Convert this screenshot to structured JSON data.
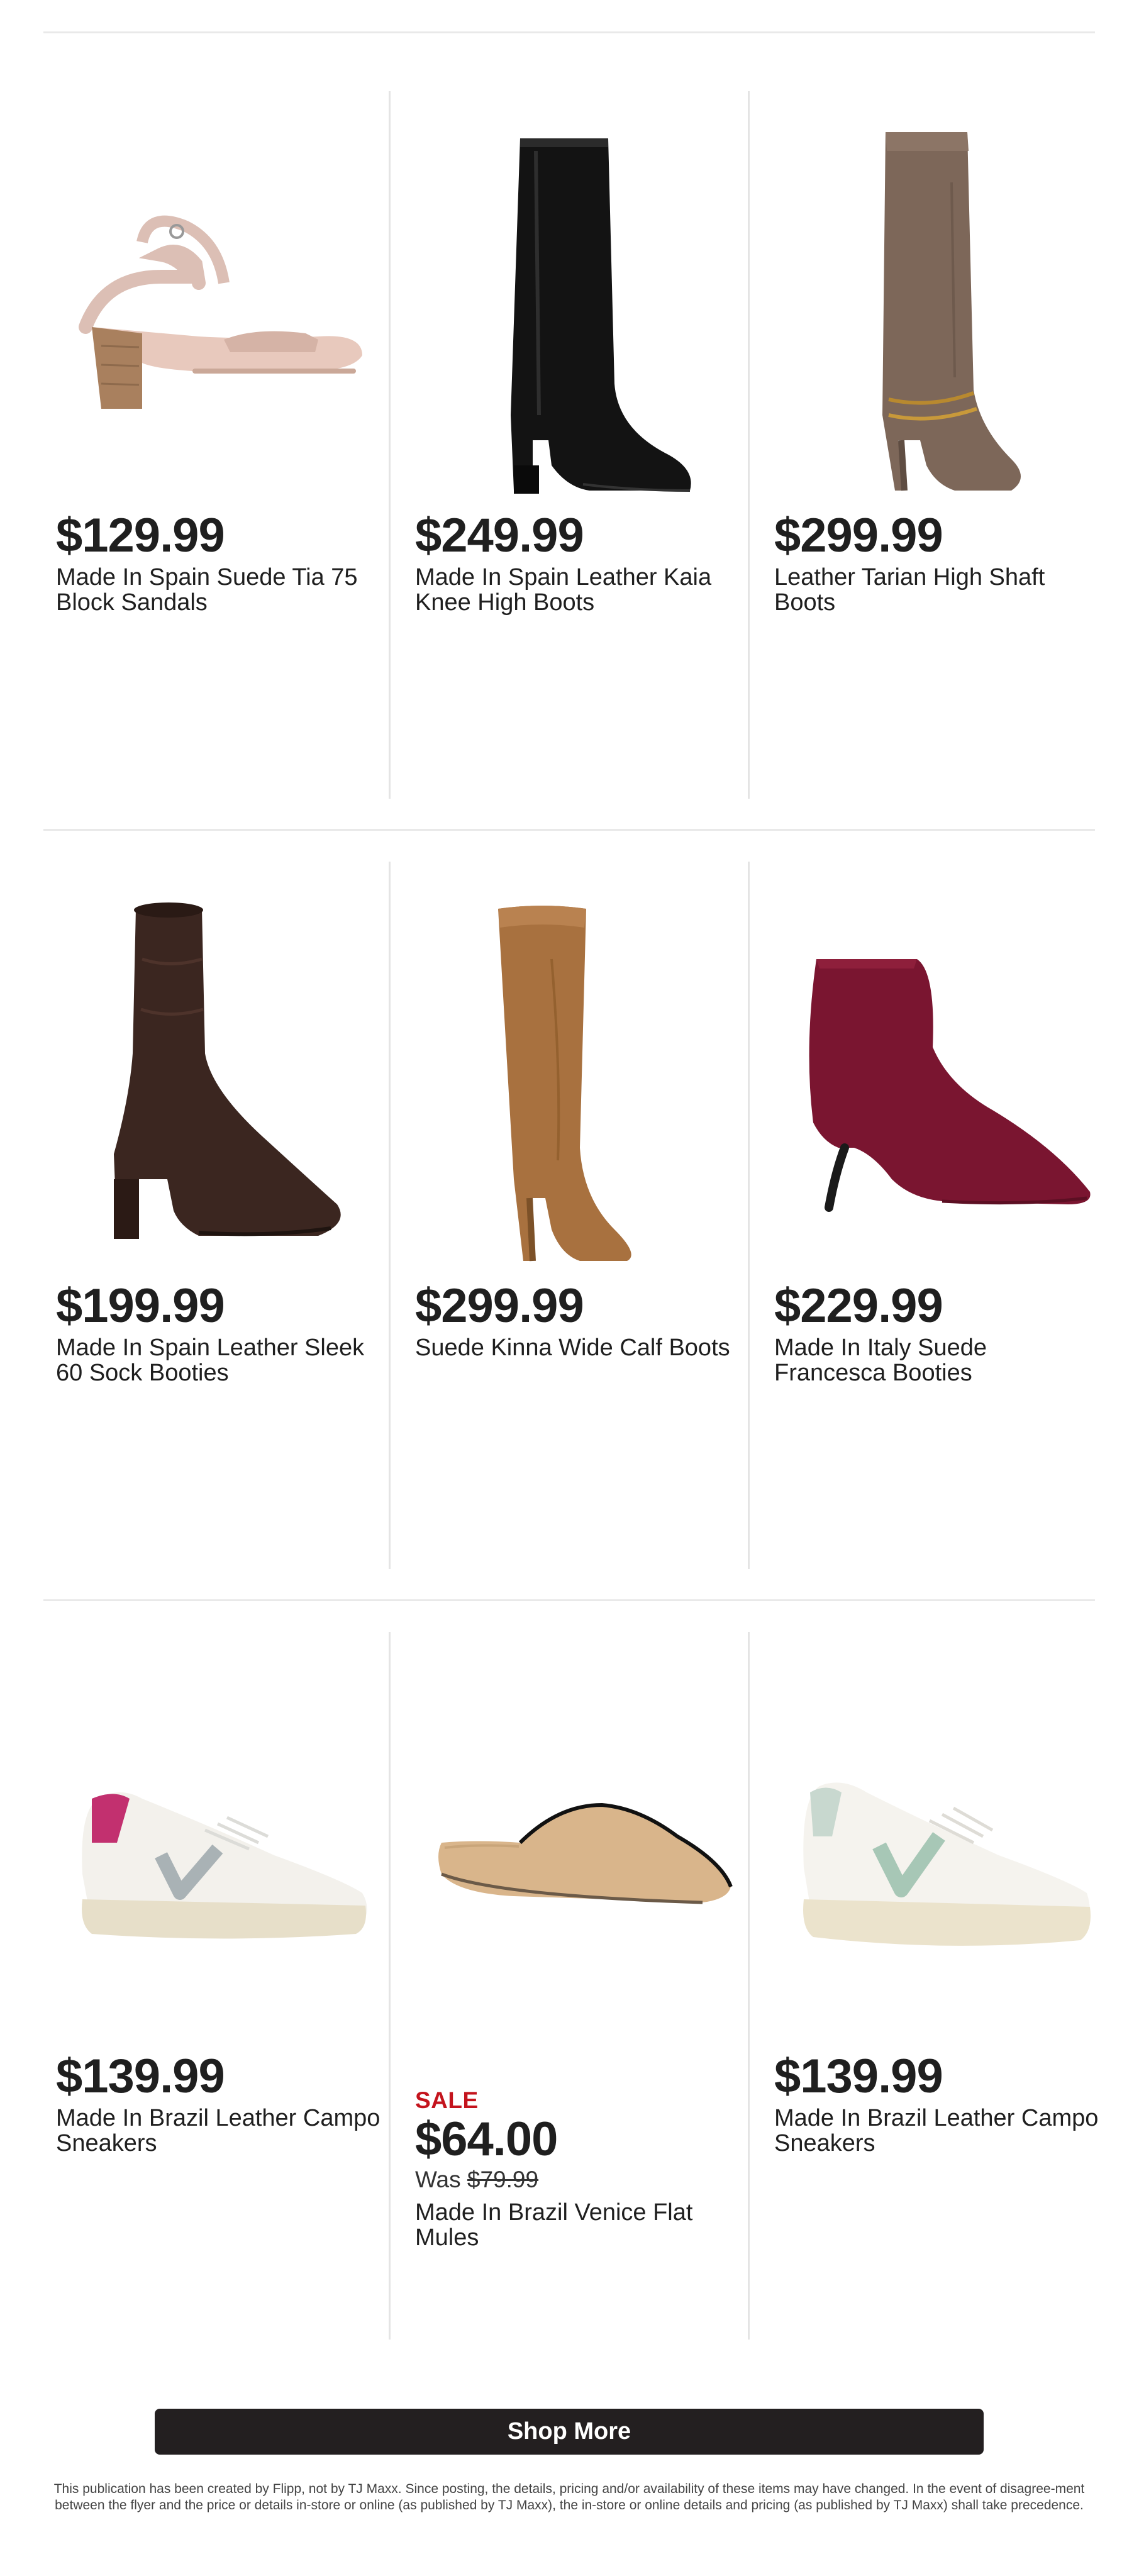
{
  "products": [
    {
      "price": "$129.99",
      "name_line1": "Made In Spain Suede Tia 75",
      "name_line2": "Block Sandals",
      "image_icon": "sandal-image"
    },
    {
      "price": "$249.99",
      "name_line1": "Made In Spain Leather Kaia",
      "name_line2": "Knee High Boots",
      "image_icon": "knee-boot-image"
    },
    {
      "price": "$299.99",
      "name_line1": "Leather Tarian High Shaft",
      "name_line2": "Boots",
      "image_icon": "high-shaft-boot-image"
    },
    {
      "price": "$199.99",
      "name_line1": "Made In Spain Leather Sleek",
      "name_line2": "60 Sock Booties",
      "image_icon": "sock-bootie-image"
    },
    {
      "price": "$299.99",
      "name_line1": "Suede Kinna Wide Calf Boots",
      "name_line2": "",
      "image_icon": "suede-boot-image"
    },
    {
      "price": "$229.99",
      "name_line1": "Made In Italy Suede",
      "name_line2": "Francesca Booties",
      "image_icon": "kitten-heel-bootie-image"
    },
    {
      "price": "$139.99",
      "name_line1": "Made In Brazil Leather Campo",
      "name_line2": "Sneakers",
      "image_icon": "sneaker-image"
    },
    {
      "sale_label": "SALE",
      "price": "$64.00",
      "was_label": "Was",
      "was_price": "$79.99",
      "name_line1": "Made In Brazil Venice Flat",
      "name_line2": "Mules",
      "image_icon": "mule-image"
    },
    {
      "price": "$139.99",
      "name_line1": "Made In Brazil Leather Campo",
      "name_line2": "Sneakers",
      "image_icon": "sneaker-image"
    }
  ],
  "shop_more_label": "Shop More",
  "disclaimer": "This publication has been created by Flipp, not by TJ Maxx. Since posting, the details, pricing and/or availability of these items may have changed. In the event of disagree-ment between the flyer and the price or details in-store or online (as published by TJ Maxx), the in-store or online details and pricing (as published by TJ Maxx) shall take precedence.",
  "colors": {
    "sale_red": "#c4141d",
    "button_bg": "#231f20",
    "divider": "#e9e9e9"
  }
}
